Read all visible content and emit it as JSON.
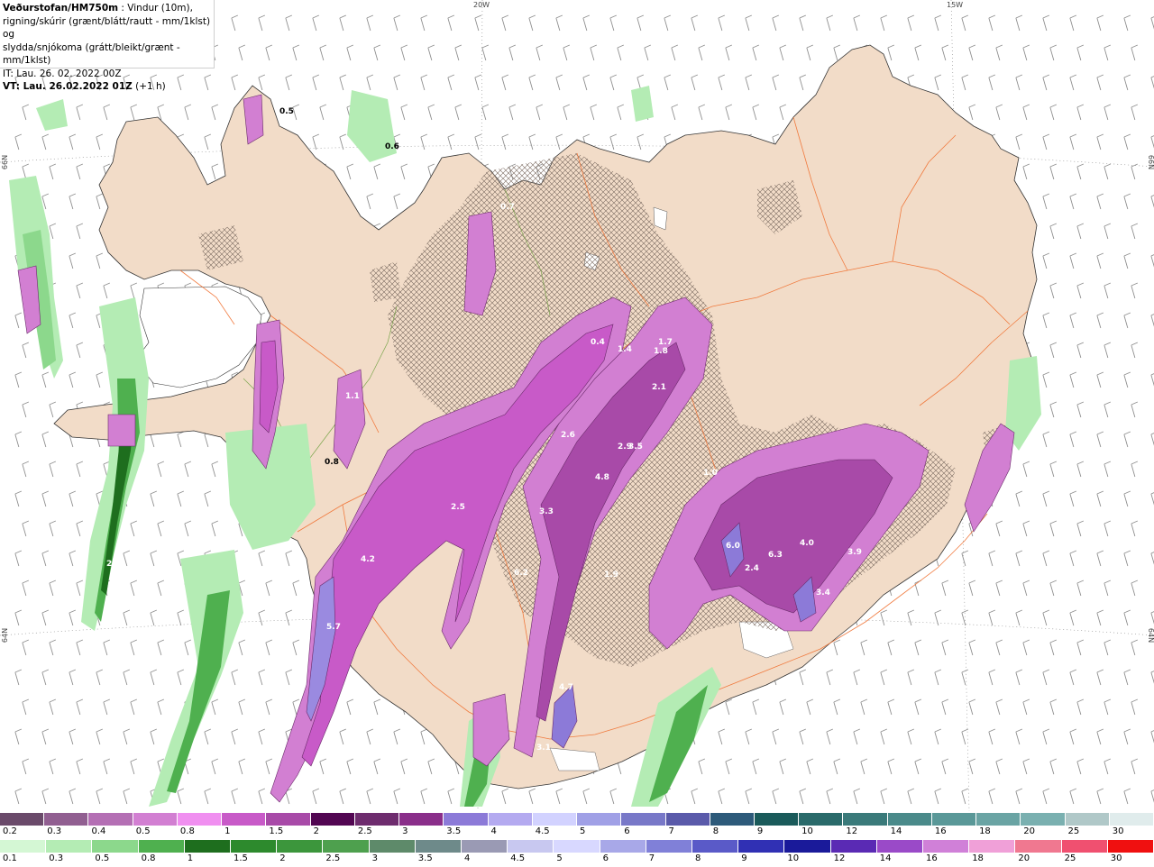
{
  "header": {
    "brand": "Veðurstofan/HM750m",
    "desc1": " : Vindur (10m),",
    "desc2": "rigning/skúrir (grænt/blátt/rautt - mm/1klst) og",
    "desc3": "slydda/snjókoma (grátt/bleikt/grænt - mm/1klst)",
    "it": "IT: Lau. 26. 02. 2022 00Z",
    "vt_label": "VT: Lau. 26.02.2022 01Z",
    "vt_offset": " (+1 h)"
  },
  "graticule": {
    "lon_labels": [
      "20W",
      "15W"
    ],
    "lat_labels_left": [
      "66N",
      "64N"
    ],
    "lat_labels_right": [
      "66N",
      "64N"
    ]
  },
  "legend_snow": {
    "labels": [
      "0.2",
      "0.3",
      "0.4",
      "0.5",
      "0.8",
      "1",
      "1.5",
      "2",
      "2.5",
      "3",
      "3.5",
      "4",
      "4.5",
      "5",
      "6",
      "7",
      "8",
      "9",
      "10",
      "12",
      "14",
      "16",
      "18",
      "20",
      "25",
      "30"
    ],
    "colors": [
      "#6a4a6a",
      "#915f91",
      "#b46fb4",
      "#d27fd2",
      "#f08ff0",
      "#c85ac8",
      "#a84aa8",
      "#520652",
      "#6e2c6e",
      "#8a2e8a",
      "#8c7ad8",
      "#b4aaf0",
      "#d2d2ff",
      "#a0a0e6",
      "#7878c8",
      "#5a5aaa",
      "#2d5a7a",
      "#1a5a5a",
      "#2a6a6a",
      "#3a7a7a",
      "#4a8a8a",
      "#5a9898",
      "#6aa4a4",
      "#7ab0b0",
      "#b0c8c8",
      "#e0ecec"
    ]
  },
  "legend_rain": {
    "labels": [
      "0.1",
      "0.3",
      "0.5",
      "0.8",
      "1",
      "1.5",
      "2",
      "2.5",
      "3",
      "3.5",
      "4",
      "4.5",
      "5",
      "6",
      "7",
      "8",
      "9",
      "10",
      "12",
      "14",
      "16",
      "18",
      "20",
      "25",
      "30"
    ],
    "colors": [
      "#d4f7d4",
      "#b4ecb4",
      "#8cd88c",
      "#4fb04f",
      "#1e6e1e",
      "#2d8a2d",
      "#3c963c",
      "#4ea04e",
      "#5e8a6a",
      "#6e8a8a",
      "#9a9ab4",
      "#c8c8f0",
      "#d8d8ff",
      "#a8a8e8",
      "#8080d8",
      "#5a5ac8",
      "#3030b4",
      "#1a1a9a",
      "#5a2ab4",
      "#9a4ac8",
      "#d080d8",
      "#f0a0d8",
      "#f07890",
      "#f05070",
      "#f01010"
    ]
  },
  "value_labels": [
    "0.5",
    "0.6",
    "0.7",
    "0.4",
    "1.4",
    "1.7",
    "1.8",
    "2.1",
    "2.6",
    "2.9",
    "3.5",
    "4.8",
    "3.3",
    "6.2",
    "1.9",
    "1.0",
    "2.4",
    "4.0",
    "6.3",
    "6.0",
    "3.9",
    "3.4",
    "2.5",
    "4.2",
    "5.7",
    "4.7",
    "3.1",
    "1.1",
    "0.8",
    "2.3"
  ],
  "colors": {
    "land": "#f2dcc8",
    "ocean": "#ffffff",
    "roads": "#f07030",
    "rivers": "#70a040",
    "wind_barbs": "#909090",
    "snow_main": "#c060d0",
    "rain_main": "#208020"
  }
}
